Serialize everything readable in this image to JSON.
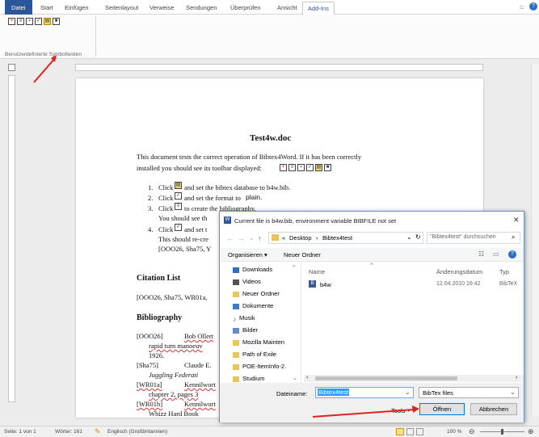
{
  "ribbon": {
    "tabs": [
      "Datei",
      "Start",
      "Einfügen",
      "Seitenlayout",
      "Verweise",
      "Sendungen",
      "Überprüfen",
      "Ansicht",
      "Add-Ins"
    ],
    "active_tab": "Add-Ins",
    "group_label": "Benutzerdefinierte Symbolleisten"
  },
  "document": {
    "title": "Test4w.doc",
    "intro_1": "This  document  tests  the  correct  operation  of  Bibtex4Word.  If  it  has  been  correctly",
    "intro_2": "installed  you  should  see  its  toolbar  displayed:",
    "step1": "and set the bibtex database to b4w.bib.",
    "step2_a": "and set the format to",
    "step2_b": "plain.",
    "step3": "to create the bibliography.",
    "step3_line2": "You should see th",
    "step4": "and set t",
    "step4_line2": "This should re-cre",
    "step4_line3": "[OOO26, Sha75, Y",
    "click": "Click",
    "n1": "1.",
    "n2": "2.",
    "n3": "3.",
    "n4": "4.",
    "citation_heading": "Citation List",
    "citation_line": "[OOO26, Sha75, WR01a,",
    "bibliography_heading": "Bibliography",
    "bib": [
      {
        "key": "[OOO26]",
        "l1": "Bob Ollert",
        "l2": "rapid turn manoeuv",
        "l3": "1926."
      },
      {
        "key": "[Sha75]",
        "l1": "Claude E.",
        "l2": "Juggling Federati"
      },
      {
        "key": "[WR01a]",
        "l1": "Kennilwort",
        "l2": "chapter 2, pages 3"
      },
      {
        "key": "[WR01b]",
        "l1": "Kennilwort",
        "l2": "Whizz Hard Book"
      }
    ]
  },
  "dialog": {
    "title": "Current file is b4w.bib, environment variable BIBFILE not set",
    "close": "✕",
    "path": [
      "Desktop",
      "Bibtex4test"
    ],
    "path_prefix": "«",
    "search_placeholder": "\"Bibtex4test\" durchsuchen",
    "organize": "Organisieren ▾",
    "new_folder": "Neuer Ordner",
    "columns": {
      "name": "Name",
      "date": "Änderungsdatum",
      "type": "Typ"
    },
    "nav": [
      {
        "label": "Downloads",
        "color": "#2b6fc1"
      },
      {
        "label": "Videos",
        "color": "#555"
      },
      {
        "label": "Neuer Ordner",
        "color": "#e8c45a"
      },
      {
        "label": "Dokumente",
        "color": "#3d7bc9"
      },
      {
        "label": "Musik",
        "color": "#2b6fc1"
      },
      {
        "label": "Bilder",
        "color": "#5e8fc8"
      },
      {
        "label": "Mozilla Mainten",
        "color": "#e8c45a"
      },
      {
        "label": "Path of Exile",
        "color": "#e8c45a"
      },
      {
        "label": "POE-ItemInfo-2.",
        "color": "#e8c45a"
      },
      {
        "label": "Studium",
        "color": "#e8c45a"
      }
    ],
    "file": {
      "name": "b4w",
      "date": "12.04.2010 16:42",
      "type": "BibTeX"
    },
    "filename_label": "Dateiname:",
    "filename_value": "Bibtex4test",
    "filetype": "BibTex files",
    "tools": "Tools",
    "open": "Öffnen",
    "cancel": "Abbrechen"
  },
  "status": {
    "page": "Seite: 1 von 1",
    "words": "Wörter: 161",
    "lang": "Englisch (Großbritannien)",
    "zoom": "100 %"
  },
  "colors": {
    "accent": "#2b579a",
    "arrow": "#e02020",
    "toolbar_icon": "#c00000"
  }
}
